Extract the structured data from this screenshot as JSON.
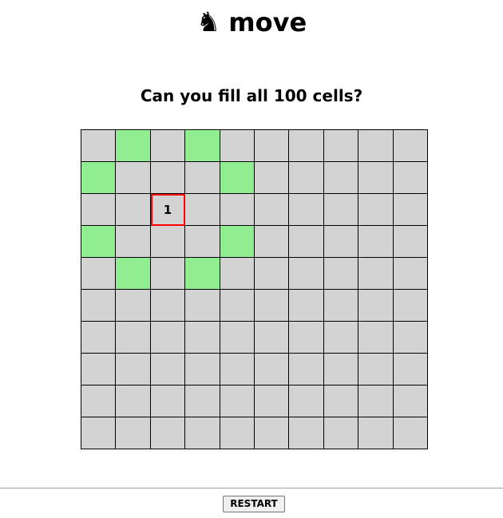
{
  "app": {
    "title": "move",
    "title_icon": "♞",
    "subtitle": "Can you fill all 100 cells?"
  },
  "board": {
    "rows": 10,
    "cols": 10,
    "current": {
      "row": 2,
      "col": 2,
      "label": "1"
    },
    "valid_moves": [
      [
        0,
        1
      ],
      [
        0,
        3
      ],
      [
        1,
        0
      ],
      [
        1,
        4
      ],
      [
        3,
        0
      ],
      [
        3,
        4
      ],
      [
        4,
        1
      ],
      [
        4,
        3
      ]
    ],
    "colors": {
      "empty": "#d3d3d3",
      "valid_move": "#90ee90",
      "current_border": "#ff0000"
    }
  },
  "controls": {
    "restart_label": "RESTART"
  }
}
